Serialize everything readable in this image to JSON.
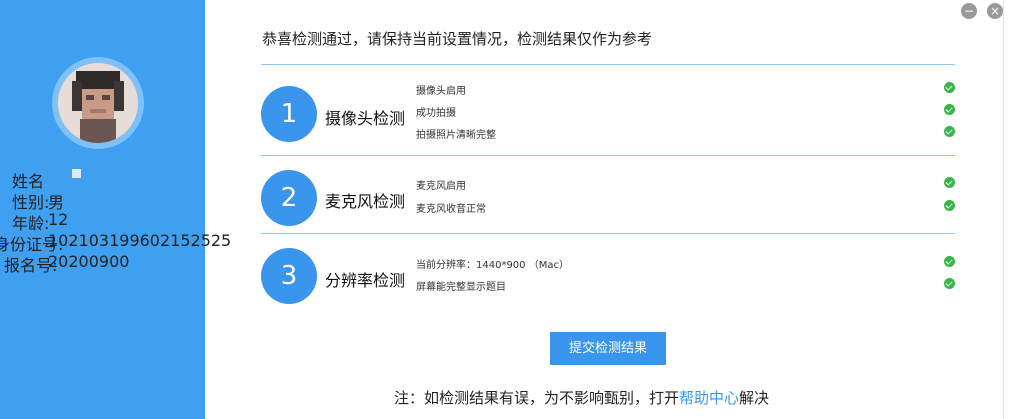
{
  "sidebar": {
    "name_label": "姓名",
    "gender_label": "性别:",
    "gender_value": "男",
    "age_label": "年龄:",
    "age_value": "12",
    "id_label": "身份证号:",
    "id_value": "102103199602152525",
    "exam_label": "报名号:",
    "exam_value": "20200900"
  },
  "main": {
    "title": "恭喜检测通过，请保持当前设置情况，检测结果仅作为参考",
    "sections": [
      {
        "number": "1",
        "title": "摄像头检测",
        "items": [
          "摄像头启用",
          "成功拍摄",
          "拍摄照片清晰完整"
        ]
      },
      {
        "number": "2",
        "title": "麦克风检测",
        "items": [
          "麦克风启用",
          "麦克风收音正常"
        ]
      },
      {
        "number": "3",
        "title": "分辨率检测",
        "items": [
          "当前分辨率：1440*900 （Mac）",
          "屏幕能完整显示题目"
        ]
      }
    ],
    "submit_label": "提交检测结果",
    "note_prefix": "注：如检测结果有误，为不影响甄别，打开",
    "note_link": "帮助中心",
    "note_suffix": "解决"
  },
  "window": {
    "minimize_label": "−",
    "close_label": "×"
  },
  "colors": {
    "sidebar": "#3f9ff0",
    "accent": "#3a96ec",
    "check": "#3ab54a"
  }
}
